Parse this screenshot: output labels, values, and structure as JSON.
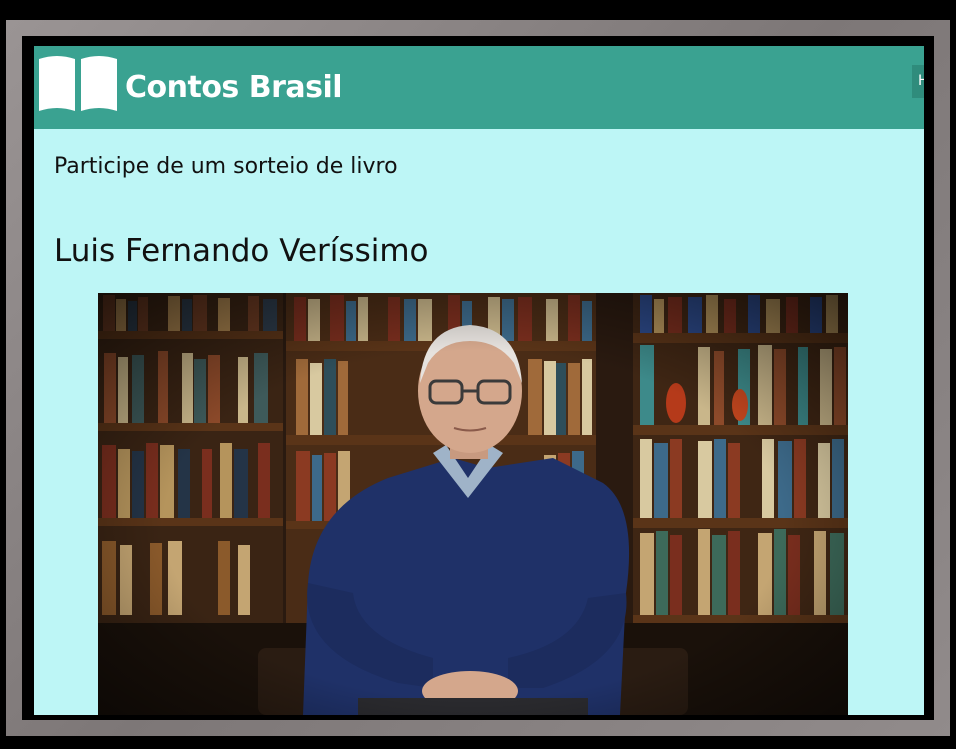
{
  "header": {
    "site_title": "Contos Brasil",
    "logo_icon": "open-book-icon",
    "nav_button_label": "H"
  },
  "main": {
    "giveaway_link": "Participe de um sorteio de livro",
    "author_name": "Luis Fernando Veríssimo",
    "author_photo": "author-portrait-bookshelves"
  },
  "colors": {
    "header_bg": "#3aa291",
    "page_bg": "#bdf6f6",
    "frame_grey": "#8a8484"
  }
}
